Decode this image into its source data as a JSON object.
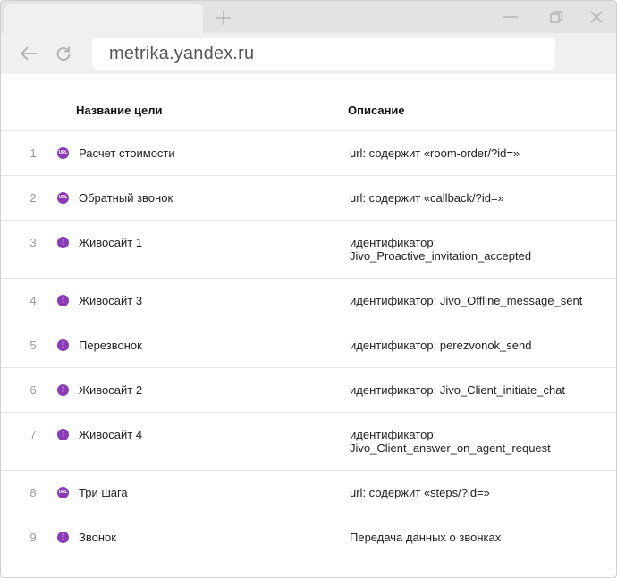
{
  "browser": {
    "url": "metrika.yandex.ru"
  },
  "table": {
    "headers": {
      "name": "Название цели",
      "description": "Описание"
    },
    "rows": [
      {
        "num": "1",
        "icon": "url-icon",
        "badge": "URL",
        "name": "Расчет стоимости",
        "desc_lines": [
          "url: содержит «room-order/?id=»"
        ]
      },
      {
        "num": "2",
        "icon": "url-icon",
        "badge": "URL",
        "name": "Обратный звонок",
        "desc_lines": [
          "url: содержит «callback/?id=»"
        ]
      },
      {
        "num": "3",
        "icon": "exclamation-icon",
        "badge": "!",
        "name": "Живосайт 1",
        "desc_lines": [
          "идентификатор:",
          "Jivo_Proactive_invitation_accepted"
        ]
      },
      {
        "num": "4",
        "icon": "exclamation-icon",
        "badge": "!",
        "name": "Живосайт 3",
        "desc_lines": [
          "идентификатор: Jivo_Offline_message_sent"
        ]
      },
      {
        "num": "5",
        "icon": "exclamation-icon",
        "badge": "!",
        "name": "Перезвонок",
        "desc_lines": [
          "идентификатор: perezvonok_send"
        ]
      },
      {
        "num": "6",
        "icon": "exclamation-icon",
        "badge": "!",
        "name": "Живосайт 2",
        "desc_lines": [
          "идентификатор: Jivo_Client_initiate_chat"
        ]
      },
      {
        "num": "7",
        "icon": "exclamation-icon",
        "badge": "!",
        "name": "Живосайт 4",
        "desc_lines": [
          "идентификатор:",
          "Jivo_Client_answer_on_agent_request"
        ]
      },
      {
        "num": "8",
        "icon": "url-icon",
        "badge": "URL",
        "name": "Три шага",
        "desc_lines": [
          "url: содержит «steps/?id=»"
        ]
      },
      {
        "num": "9",
        "icon": "exclamation-icon",
        "badge": "!",
        "name": "Звонок",
        "desc_lines": [
          "Передача данных о звонках"
        ]
      }
    ]
  },
  "colors": {
    "badge": "#8a3bb8",
    "tabstrip": "#e3e3e3",
    "toolbar": "#f0f0f0"
  }
}
